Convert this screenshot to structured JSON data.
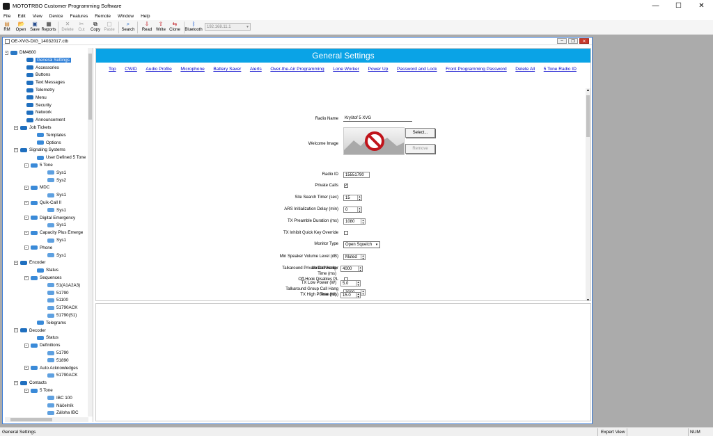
{
  "titlebar": {
    "title": "MOTOTRBO Customer Programming Software",
    "min": "—",
    "max": "☐",
    "close": "✕"
  },
  "menu": [
    "File",
    "Edit",
    "View",
    "Device",
    "Features",
    "Remote",
    "Window",
    "Help"
  ],
  "toolbar": {
    "items": [
      {
        "label": "RM",
        "icon": "rm-icon",
        "enabled": true
      },
      {
        "label": "Open",
        "icon": "open-folder-icon",
        "enabled": true
      },
      {
        "label": "Save",
        "icon": "save-icon",
        "enabled": true
      },
      {
        "label": "Reports",
        "icon": "reports-icon",
        "enabled": true
      },
      {
        "label": "Delete",
        "icon": "delete-icon",
        "enabled": false
      },
      {
        "label": "Cut",
        "icon": "cut-icon",
        "enabled": false
      },
      {
        "label": "Copy",
        "icon": "copy-icon",
        "enabled": true
      },
      {
        "label": "Paste",
        "icon": "paste-icon",
        "enabled": false
      },
      {
        "label": "Search",
        "icon": "search-icon",
        "enabled": true
      },
      {
        "label": "Read",
        "icon": "read-icon",
        "enabled": true
      },
      {
        "label": "Write",
        "icon": "write-icon",
        "enabled": true
      },
      {
        "label": "Clone",
        "icon": "clone-icon",
        "enabled": true
      },
      {
        "label": "Bluetooth",
        "icon": "bluetooth-icon",
        "enabled": true
      }
    ],
    "ip_value": "192.168.11.1"
  },
  "doc": {
    "title": "OE-XVG-DIG_14032017.ctb"
  },
  "tree": [
    {
      "label": "DM4600",
      "depth": 0,
      "exp": "−",
      "sel": false
    },
    {
      "label": "General Settings",
      "depth": 1,
      "exp": "",
      "sel": true
    },
    {
      "label": "Accessories",
      "depth": 1,
      "exp": "",
      "sel": false
    },
    {
      "label": "Buttons",
      "depth": 1,
      "exp": "",
      "sel": false
    },
    {
      "label": "Text Messages",
      "depth": 1,
      "exp": "",
      "sel": false
    },
    {
      "label": "Telemetry",
      "depth": 1,
      "exp": "",
      "sel": false
    },
    {
      "label": "Menu",
      "depth": 1,
      "exp": "",
      "sel": false
    },
    {
      "label": "Security",
      "depth": 1,
      "exp": "",
      "sel": false
    },
    {
      "label": "Network",
      "depth": 1,
      "exp": "",
      "sel": false
    },
    {
      "label": "Announcement",
      "depth": 1,
      "exp": "",
      "sel": false
    },
    {
      "label": "Job Tickets",
      "depth": 1,
      "exp": "−",
      "sel": false
    },
    {
      "label": "Templates",
      "depth": 2,
      "exp": "",
      "sel": false
    },
    {
      "label": "Options",
      "depth": 2,
      "exp": "",
      "sel": false
    },
    {
      "label": "Signaling Systems",
      "depth": 1,
      "exp": "−",
      "sel": false
    },
    {
      "label": "User Defined 5 Tone",
      "depth": 2,
      "exp": "",
      "sel": false
    },
    {
      "label": "5 Tone",
      "depth": 2,
      "exp": "−",
      "sel": false
    },
    {
      "label": "Sys1",
      "depth": 3,
      "exp": "",
      "sel": false
    },
    {
      "label": "Sys2",
      "depth": 3,
      "exp": "",
      "sel": false
    },
    {
      "label": "MDC",
      "depth": 2,
      "exp": "−",
      "sel": false
    },
    {
      "label": "Sys1",
      "depth": 3,
      "exp": "",
      "sel": false
    },
    {
      "label": "Quik-Call II",
      "depth": 2,
      "exp": "−",
      "sel": false
    },
    {
      "label": "Sys1",
      "depth": 3,
      "exp": "",
      "sel": false
    },
    {
      "label": "Digital Emergency",
      "depth": 2,
      "exp": "−",
      "sel": false
    },
    {
      "label": "Sys1",
      "depth": 3,
      "exp": "",
      "sel": false
    },
    {
      "label": "Capacity Plus Emerge",
      "depth": 2,
      "exp": "−",
      "sel": false
    },
    {
      "label": "Sys1",
      "depth": 3,
      "exp": "",
      "sel": false
    },
    {
      "label": "Phone",
      "depth": 2,
      "exp": "−",
      "sel": false
    },
    {
      "label": "Sys1",
      "depth": 3,
      "exp": "",
      "sel": false
    },
    {
      "label": "Encoder",
      "depth": 1,
      "exp": "−",
      "sel": false
    },
    {
      "label": "Status",
      "depth": 2,
      "exp": "",
      "sel": false
    },
    {
      "label": "Sequences",
      "depth": 2,
      "exp": "−",
      "sel": false
    },
    {
      "label": "51(A1A2A3)",
      "depth": 3,
      "exp": "",
      "sel": false
    },
    {
      "label": "51790",
      "depth": 3,
      "exp": "",
      "sel": false
    },
    {
      "label": "51100",
      "depth": 3,
      "exp": "",
      "sel": false
    },
    {
      "label": "51790ACK",
      "depth": 3,
      "exp": "",
      "sel": false
    },
    {
      "label": "51790(S1)",
      "depth": 3,
      "exp": "",
      "sel": false
    },
    {
      "label": "Telegrams",
      "depth": 2,
      "exp": "",
      "sel": false
    },
    {
      "label": "Decoder",
      "depth": 1,
      "exp": "−",
      "sel": false
    },
    {
      "label": "Status",
      "depth": 2,
      "exp": "",
      "sel": false
    },
    {
      "label": "Definitions",
      "depth": 2,
      "exp": "−",
      "sel": false
    },
    {
      "label": "51790",
      "depth": 3,
      "exp": "",
      "sel": false
    },
    {
      "label": "51890",
      "depth": 3,
      "exp": "",
      "sel": false
    },
    {
      "label": "Auto Acknowledges",
      "depth": 2,
      "exp": "−",
      "sel": false
    },
    {
      "label": "51790ACK",
      "depth": 3,
      "exp": "",
      "sel": false
    },
    {
      "label": "Contacts",
      "depth": 1,
      "exp": "−",
      "sel": false
    },
    {
      "label": "5 Tone",
      "depth": 2,
      "exp": "−",
      "sel": false
    },
    {
      "label": "IBC 100",
      "depth": 3,
      "exp": "",
      "sel": false
    },
    {
      "label": "Náčelník",
      "depth": 3,
      "exp": "",
      "sel": false
    },
    {
      "label": "Záloha IBC",
      "depth": 3,
      "exp": "",
      "sel": false
    }
  ],
  "settings": {
    "banner": "General Settings",
    "links": [
      "Top",
      "CWID",
      "Audio Profile",
      "Microphone",
      "Battery Saver",
      "Alerts",
      "Over-the-Air Programming",
      "Lone Worker",
      "Power Up",
      "Password and Lock",
      "Front Programming Password",
      "Delete All",
      "5 Tone Radio ID"
    ],
    "radio_name_label": "Radio Name",
    "radio_name": "Kryštof 5 XVG",
    "welcome_image_label": "Welcome Image",
    "select_btn": "Select...",
    "remove_btn": "Remove",
    "radio_id_label": "Radio ID",
    "radio_id": "15551790",
    "private_calls_label": "Private Calls",
    "private_calls_mark": "✓",
    "site_search_label": "Site Search Timer (sec)",
    "site_search": "15",
    "ars_label": "ARS Initialization Delay (min)",
    "ars": "0",
    "tx_preamble_label": "TX Preamble Duration (ms)",
    "tx_preamble": "1080",
    "tx_inhibit_label": "TX Inhibit Quick Key Override",
    "monitor_type_label": "Monitor Type",
    "monitor_type": "Open Squelch",
    "min_spk_label": "Min Speaker Volume Level (dB)",
    "min_spk": "Muted",
    "unlink_label": "Unlink Monitor",
    "offhook_label": "Off-Hook Disables PL",
    "ta_group_label1": "Talkaround Group Call Hang",
    "ta_group_label2": "Time (ms)",
    "ta_group": "3000",
    "ta_private_label1": "Talkaround Private Call Hang",
    "ta_private_label2": "Time (ms)",
    "ta_private": "4000",
    "tx_low_label": "TX Low Power (W)",
    "tx_low": "5.0",
    "tx_high_label": "TX High Power (W)",
    "tx_high": "15.0"
  },
  "status": {
    "left": "General Settings",
    "view": "Expert View",
    "num": "NUM"
  }
}
